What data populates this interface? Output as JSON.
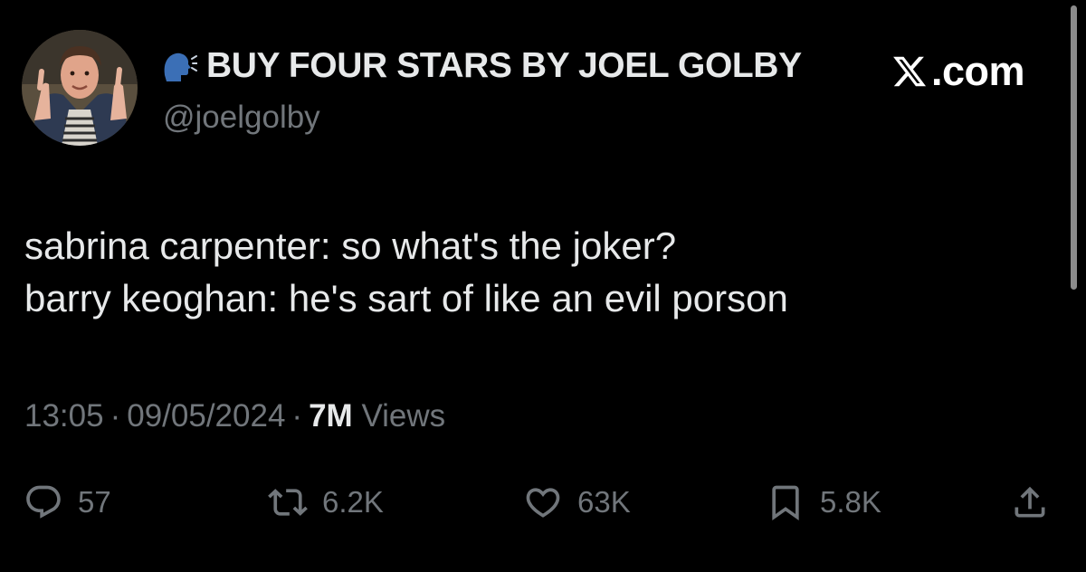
{
  "header": {
    "display_name": "BUY FOUR STARS BY JOEL GOLBY",
    "handle": "@joelgolby",
    "brand": ".com"
  },
  "tweet": {
    "lines": [
      "sabrina carpenter: so what's the joker?",
      "barry keoghan: he's sart of like an evil porson"
    ]
  },
  "meta": {
    "time": "13:05",
    "separator": "·",
    "date": "09/05/2024",
    "views_count": "7M",
    "views_label": "Views"
  },
  "actions": {
    "replies": "57",
    "reposts": "6.2K",
    "likes": "63K",
    "bookmarks": "5.8K"
  },
  "colors": {
    "background": "#000000",
    "primary_text": "#e7e9ea",
    "secondary_text": "#71767b"
  },
  "icons": {
    "display_name_prefix": "speaking-head-icon",
    "brand_logo": "x-logo-icon",
    "reply": "reply-icon",
    "repost": "repost-icon",
    "like": "heart-icon",
    "bookmark": "bookmark-icon",
    "share": "share-icon"
  }
}
